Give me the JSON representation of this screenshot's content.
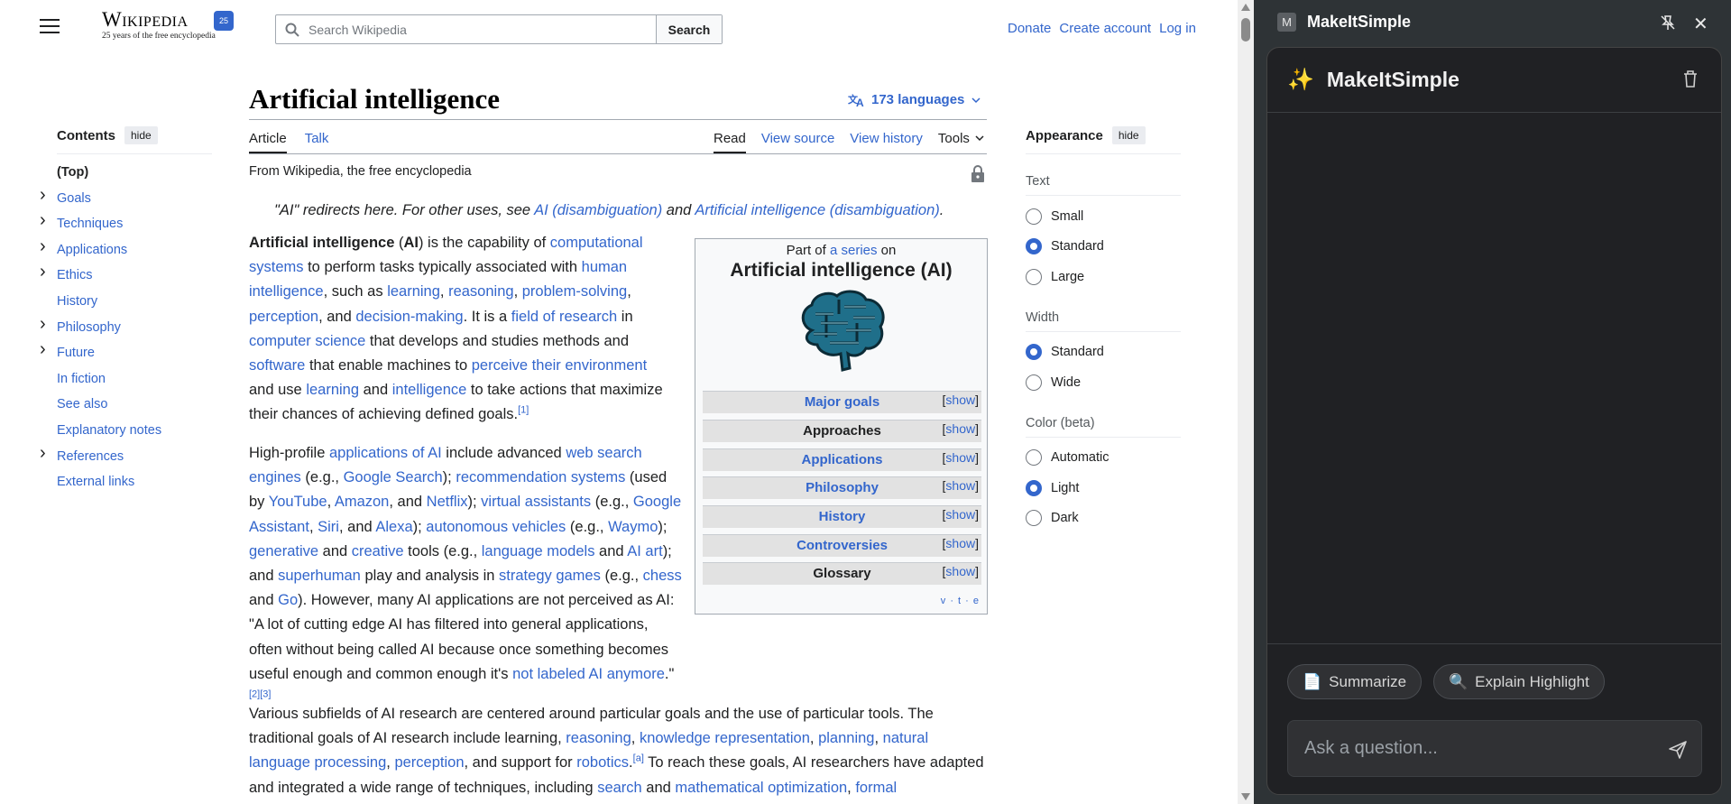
{
  "header": {
    "logo_wordmark": "Wikipedia",
    "logo_tagline": "25 years of the free encyclopedia",
    "search_placeholder": "Search Wikipedia",
    "search_button": "Search",
    "user_actions": [
      "Donate",
      "Create account",
      "Log in"
    ]
  },
  "toc": {
    "title": "Contents",
    "hide_label": "hide",
    "items": [
      {
        "label": "(Top)",
        "expandable": false
      },
      {
        "label": "Goals",
        "expandable": true
      },
      {
        "label": "Techniques",
        "expandable": true
      },
      {
        "label": "Applications",
        "expandable": true
      },
      {
        "label": "Ethics",
        "expandable": true
      },
      {
        "label": "History",
        "expandable": false
      },
      {
        "label": "Philosophy",
        "expandable": true
      },
      {
        "label": "Future",
        "expandable": true
      },
      {
        "label": "In fiction",
        "expandable": false
      },
      {
        "label": "See also",
        "expandable": false
      },
      {
        "label": "Explanatory notes",
        "expandable": false
      },
      {
        "label": "References",
        "expandable": true
      },
      {
        "label": "External links",
        "expandable": false
      }
    ]
  },
  "article": {
    "title": "Artificial intelligence",
    "languages": "173 languages",
    "tabs_left": [
      "Article",
      "Talk"
    ],
    "tabs_right": [
      "Read",
      "View source",
      "View history",
      "Tools"
    ],
    "from": "From Wikipedia, the free encyclopedia",
    "hatnote": {
      "prefix": "\"AI\" redirects here. For other uses, see ",
      "link1": "AI (disambiguation)",
      "mid": " and ",
      "link2": "Artificial intelligence (disambiguation)",
      "suffix": "."
    }
  },
  "infobox": {
    "pre": "Part of ",
    "pre_link": "a series",
    "pre_suffix": " on",
    "title": "Artificial intelligence (AI)",
    "show_label": "show",
    "rows": [
      {
        "label": "Major goals",
        "link": true
      },
      {
        "label": "Approaches",
        "link": false
      },
      {
        "label": "Applications",
        "link": true
      },
      {
        "label": "Philosophy",
        "link": true
      },
      {
        "label": "History",
        "link": true
      },
      {
        "label": "Controversies",
        "link": true
      },
      {
        "label": "Glossary",
        "link": false
      }
    ],
    "vte": "v · t · e"
  },
  "appearance": {
    "title": "Appearance",
    "hide_label": "hide",
    "groups": [
      {
        "label": "Text",
        "options": [
          "Small",
          "Standard",
          "Large"
        ],
        "selected": "Standard"
      },
      {
        "label": "Width",
        "options": [
          "Standard",
          "Wide"
        ],
        "selected": "Standard"
      },
      {
        "label": "Color (beta)",
        "options": [
          "Automatic",
          "Light",
          "Dark"
        ],
        "selected": "Light"
      }
    ]
  },
  "panel": {
    "window_title": "MakeItSimple",
    "window_icon_letter": "M",
    "card_title": "MakeItSimple",
    "summarize": "Summarize",
    "explain": "Explain Highlight",
    "ask_placeholder": "Ask a question..."
  }
}
